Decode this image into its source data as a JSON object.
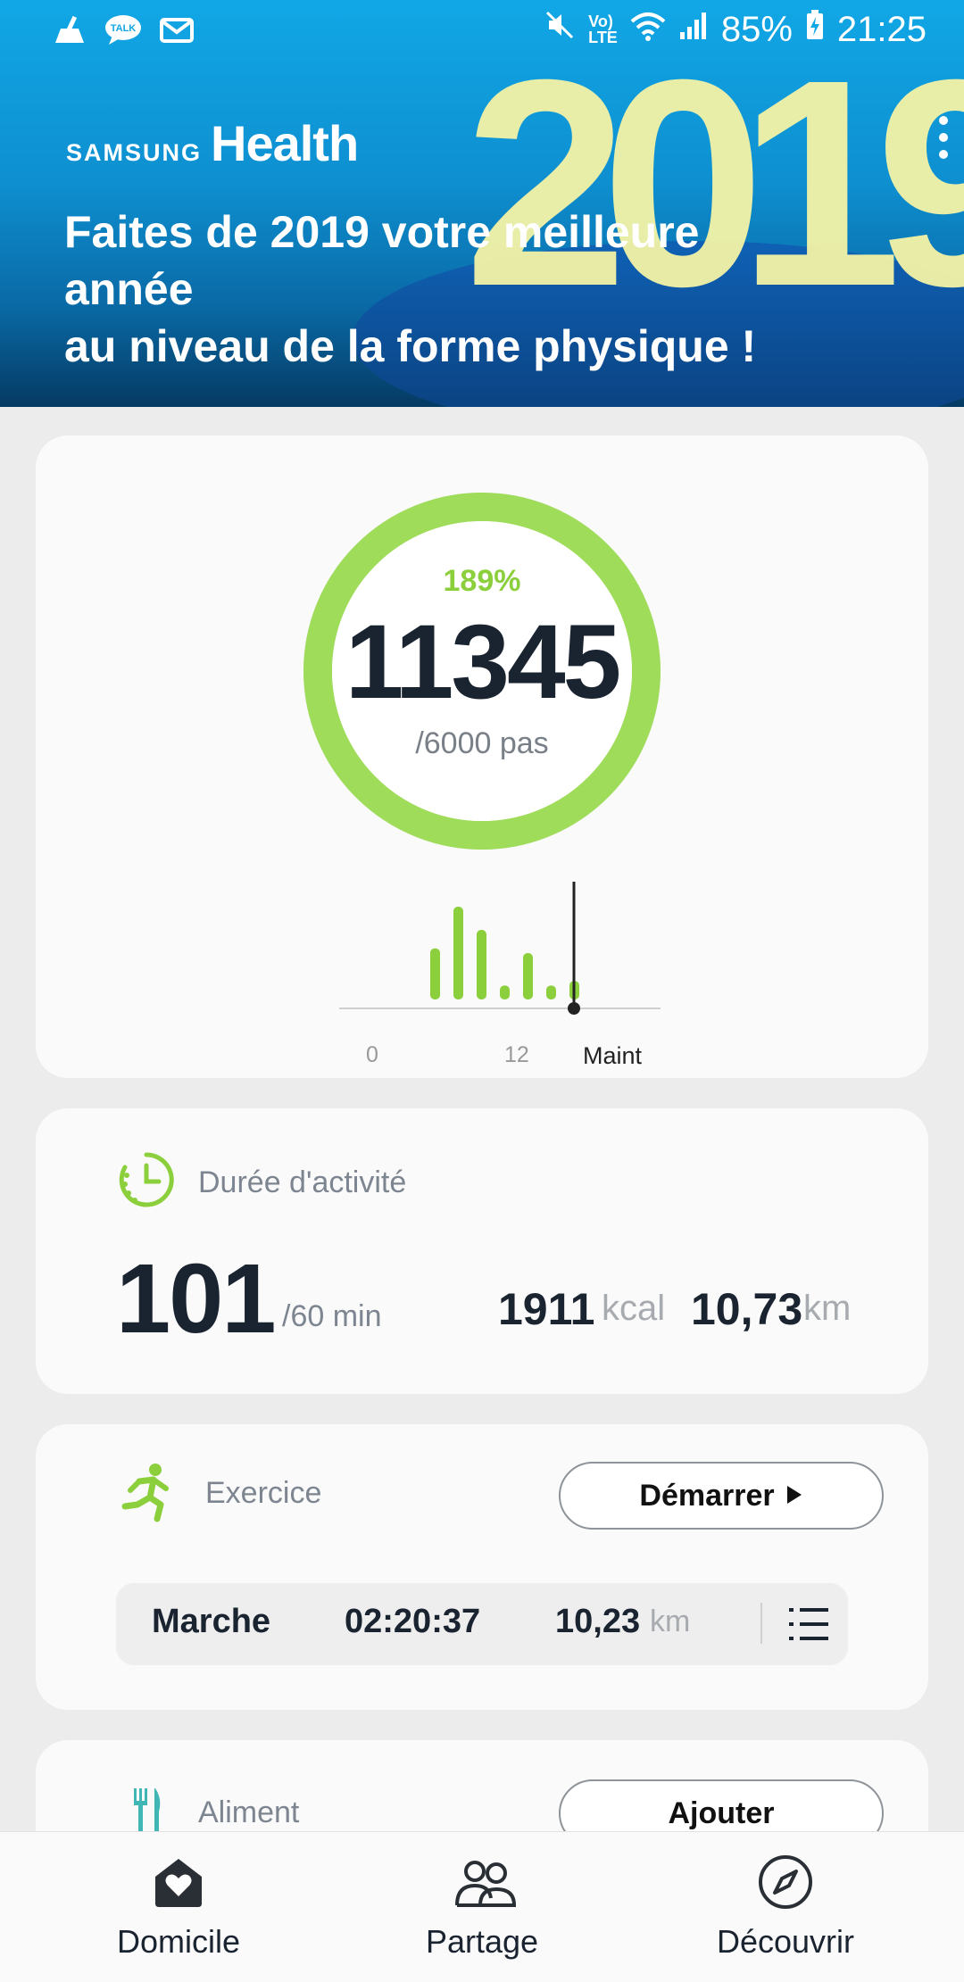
{
  "status_bar": {
    "battery": "85%",
    "time": "21:25",
    "network": "LTE",
    "icons": [
      "broom-icon",
      "talk-icon",
      "mail-icon",
      "mute-icon",
      "volte-icon",
      "wifi-icon",
      "signal-icon",
      "battery-charging-icon"
    ]
  },
  "banner": {
    "brand_samsung": "SAMSUNG",
    "brand_health": "Health",
    "year": "2019",
    "title": "Faites de 2019 votre meilleure\nannée\nau niveau de la forme physique !"
  },
  "steps": {
    "percent": "189%",
    "count": "11345",
    "goal": "/6000 pas",
    "progress": 1.0,
    "ring_color": "#9fdc5a",
    "histogram": {
      "labels": [
        "0",
        "12",
        "Maint"
      ],
      "bars": [
        0.55,
        1.0,
        0.75,
        0.15,
        0.5,
        0.15,
        0.2
      ]
    }
  },
  "activity": {
    "label": "Durée d'activité",
    "minutes": "101",
    "goal": "/60 min",
    "kcal": "1911",
    "kcal_unit": "kcal",
    "distance": "10,73",
    "distance_unit": "km"
  },
  "exercise": {
    "label": "Exercice",
    "start_button": "Démarrer",
    "latest": {
      "type": "Marche",
      "duration": "02:20:37",
      "distance": "10,23",
      "unit": "km"
    }
  },
  "food": {
    "label": "Aliment",
    "add_button": "Ajouter"
  },
  "nav": {
    "items": [
      {
        "label": "Domicile",
        "icon": "home-heart-icon"
      },
      {
        "label": "Partage",
        "icon": "people-icon"
      },
      {
        "label": "Découvrir",
        "icon": "compass-icon"
      }
    ]
  },
  "colors": {
    "accent_green": "#8ccf3c",
    "teal": "#40b6b5",
    "banner_blue": "#11a7e6"
  }
}
